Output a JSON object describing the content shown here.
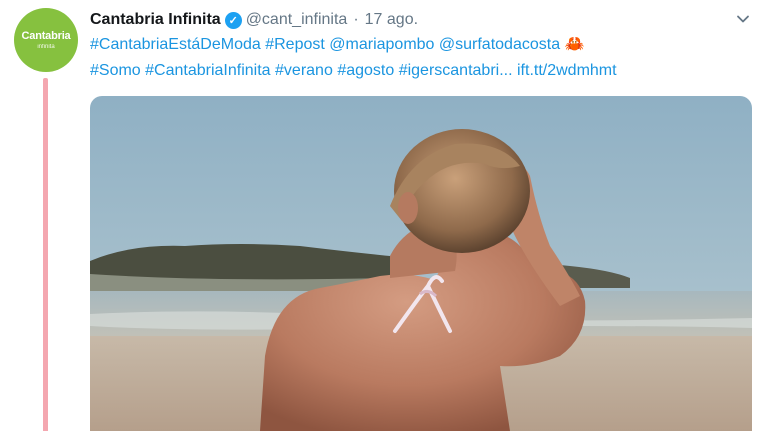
{
  "tweet": {
    "author_name": "Cantabria Infinita",
    "handle": "@cant_infinita",
    "separator": "·",
    "timestamp": "17 ago.",
    "avatar": {
      "brand": "Cantabria",
      "sub": "infinita"
    },
    "line1": [
      {
        "type": "link",
        "text": "#CantabriaEstáDeModa"
      },
      {
        "type": "space",
        "text": " "
      },
      {
        "type": "link",
        "text": "#Repost"
      },
      {
        "type": "space",
        "text": " "
      },
      {
        "type": "link",
        "text": "@mariapombo"
      },
      {
        "type": "space",
        "text": " "
      },
      {
        "type": "link",
        "text": "@surfatodacosta"
      },
      {
        "type": "space",
        "text": " "
      },
      {
        "type": "emoji",
        "text": "🦀"
      }
    ],
    "line2": [
      {
        "type": "link",
        "text": "#Somo"
      },
      {
        "type": "space",
        "text": " "
      },
      {
        "type": "link",
        "text": "#CantabriaInfinita"
      },
      {
        "type": "space",
        "text": " "
      },
      {
        "type": "link",
        "text": "#verano"
      },
      {
        "type": "space",
        "text": " "
      },
      {
        "type": "link",
        "text": "#agosto"
      },
      {
        "type": "space",
        "text": " "
      },
      {
        "type": "link",
        "text": "#igerscantabri..."
      },
      {
        "type": "space",
        "text": " "
      },
      {
        "type": "link",
        "text": "ift.tt/2wdmhmt"
      }
    ]
  },
  "colors": {
    "link": "#1b95e0",
    "verified": "#1da1f2",
    "avatar_bg": "#86c13f",
    "thread_line": "#f4a7b0"
  },
  "icons": {
    "verified": "verified-badge-icon",
    "chevron": "chevron-down-icon"
  }
}
